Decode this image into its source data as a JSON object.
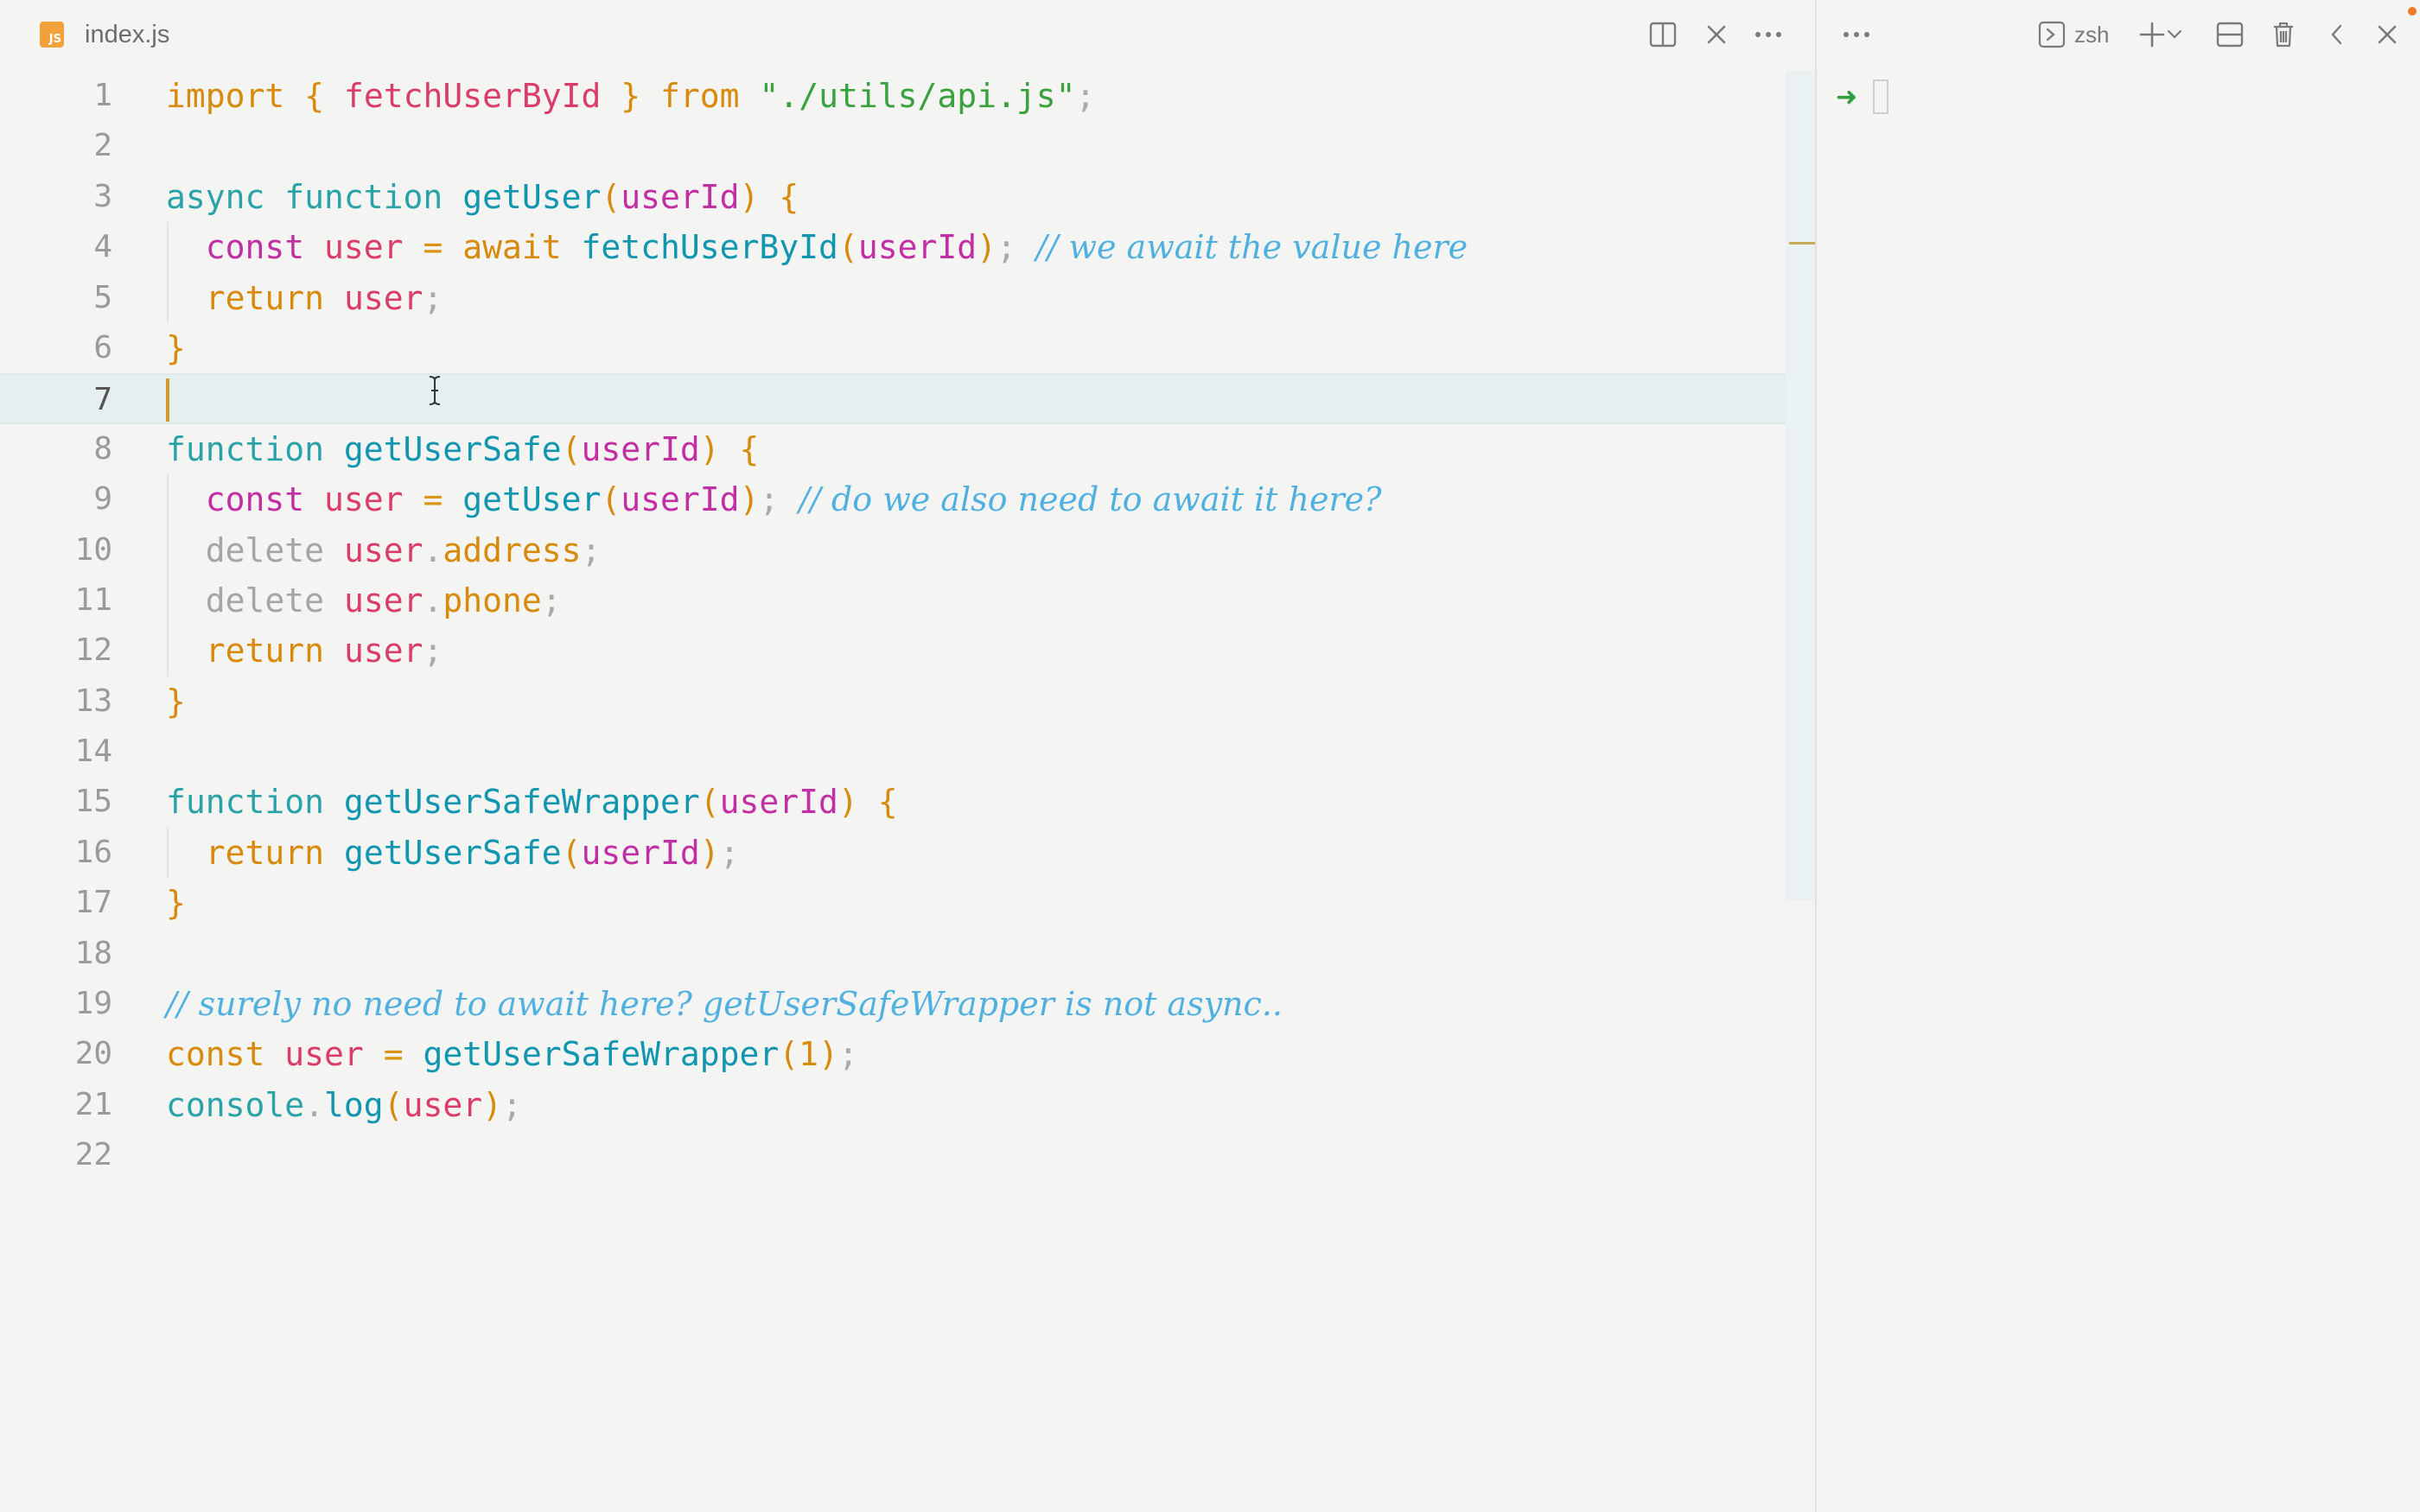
{
  "editor": {
    "tab_label": "index.js",
    "file_badge": "JS",
    "icons": [
      "split-editor-icon",
      "close-icon",
      "more-icon"
    ],
    "lines": [
      {
        "n": "1",
        "tokens": [
          [
            "import",
            "k-or"
          ],
          [
            " ",
            ""
          ],
          [
            "{",
            "br"
          ],
          [
            " ",
            ""
          ],
          [
            "fetchUserById",
            "vr"
          ],
          [
            " ",
            ""
          ],
          [
            "}",
            "br"
          ],
          [
            " ",
            ""
          ],
          [
            "from",
            "k-or"
          ],
          [
            " ",
            ""
          ],
          [
            "\"./utils/api.js\"",
            "st"
          ],
          [
            ";",
            "pu"
          ]
        ]
      },
      {
        "n": "2",
        "tokens": []
      },
      {
        "n": "3",
        "tokens": [
          [
            "async",
            "k-te"
          ],
          [
            " ",
            ""
          ],
          [
            "function",
            "k-te"
          ],
          [
            " ",
            ""
          ],
          [
            "getUser",
            "fn"
          ],
          [
            "(",
            "br"
          ],
          [
            "userId",
            "pr"
          ],
          [
            ")",
            "br"
          ],
          [
            " ",
            ""
          ],
          [
            "{",
            "br"
          ]
        ]
      },
      {
        "n": "4",
        "guide": true,
        "tokens": [
          [
            "  ",
            ""
          ],
          [
            "const",
            "pr"
          ],
          [
            " ",
            ""
          ],
          [
            "user",
            "vr"
          ],
          [
            " ",
            ""
          ],
          [
            "=",
            "pm"
          ],
          [
            " ",
            ""
          ],
          [
            "await",
            "k-or"
          ],
          [
            " ",
            ""
          ],
          [
            "fetchUserById",
            "fn"
          ],
          [
            "(",
            "br"
          ],
          [
            "userId",
            "pr"
          ],
          [
            ")",
            "br"
          ],
          [
            ";",
            "pu"
          ],
          [
            " ",
            ""
          ],
          [
            "// we await the value here",
            "cm"
          ]
        ]
      },
      {
        "n": "5",
        "guide": true,
        "tokens": [
          [
            "  ",
            ""
          ],
          [
            "return",
            "k-or"
          ],
          [
            " ",
            ""
          ],
          [
            "user",
            "vr"
          ],
          [
            ";",
            "pu"
          ]
        ]
      },
      {
        "n": "6",
        "tokens": [
          [
            "}",
            "br"
          ]
        ]
      },
      {
        "n": "7",
        "active": true,
        "tokens": []
      },
      {
        "n": "8",
        "tokens": [
          [
            "function",
            "k-te"
          ],
          [
            " ",
            ""
          ],
          [
            "getUserSafe",
            "fn"
          ],
          [
            "(",
            "br"
          ],
          [
            "userId",
            "pr"
          ],
          [
            ")",
            "br"
          ],
          [
            " ",
            ""
          ],
          [
            "{",
            "br"
          ]
        ]
      },
      {
        "n": "9",
        "guide": true,
        "tokens": [
          [
            "  ",
            ""
          ],
          [
            "const",
            "pr"
          ],
          [
            " ",
            ""
          ],
          [
            "user",
            "vr"
          ],
          [
            " ",
            ""
          ],
          [
            "=",
            "pm"
          ],
          [
            " ",
            ""
          ],
          [
            "getUser",
            "fn"
          ],
          [
            "(",
            "br"
          ],
          [
            "userId",
            "pr"
          ],
          [
            ")",
            "br"
          ],
          [
            ";",
            "pu"
          ],
          [
            " ",
            ""
          ],
          [
            "// do we also need to await it here?",
            "cm"
          ]
        ]
      },
      {
        "n": "10",
        "guide": true,
        "tokens": [
          [
            "  ",
            ""
          ],
          [
            "delete",
            "dl"
          ],
          [
            " ",
            ""
          ],
          [
            "user",
            "vr"
          ],
          [
            ".",
            "pu"
          ],
          [
            "address",
            "k-or"
          ],
          [
            ";",
            "pu"
          ]
        ]
      },
      {
        "n": "11",
        "guide": true,
        "tokens": [
          [
            "  ",
            ""
          ],
          [
            "delete",
            "dl"
          ],
          [
            " ",
            ""
          ],
          [
            "user",
            "vr"
          ],
          [
            ".",
            "pu"
          ],
          [
            "phone",
            "k-or"
          ],
          [
            ";",
            "pu"
          ]
        ]
      },
      {
        "n": "12",
        "guide": true,
        "tokens": [
          [
            "  ",
            ""
          ],
          [
            "return",
            "k-or"
          ],
          [
            " ",
            ""
          ],
          [
            "user",
            "vr"
          ],
          [
            ";",
            "pu"
          ]
        ]
      },
      {
        "n": "13",
        "tokens": [
          [
            "}",
            "br"
          ]
        ]
      },
      {
        "n": "14",
        "tokens": []
      },
      {
        "n": "15",
        "tokens": [
          [
            "function",
            "k-te"
          ],
          [
            " ",
            ""
          ],
          [
            "getUserSafeWrapper",
            "fn"
          ],
          [
            "(",
            "br"
          ],
          [
            "userId",
            "pr"
          ],
          [
            ")",
            "br"
          ],
          [
            " ",
            ""
          ],
          [
            "{",
            "br"
          ]
        ]
      },
      {
        "n": "16",
        "guide": true,
        "tokens": [
          [
            "  ",
            ""
          ],
          [
            "return",
            "k-or"
          ],
          [
            " ",
            ""
          ],
          [
            "getUserSafe",
            "fn"
          ],
          [
            "(",
            "br"
          ],
          [
            "userId",
            "pr"
          ],
          [
            ")",
            "br"
          ],
          [
            ";",
            "pu"
          ]
        ]
      },
      {
        "n": "17",
        "tokens": [
          [
            "}",
            "br"
          ]
        ]
      },
      {
        "n": "18",
        "tokens": []
      },
      {
        "n": "19",
        "tokens": [
          [
            "// surely no need to await here? getUserSafeWrapper is not async..",
            "cm"
          ]
        ]
      },
      {
        "n": "20",
        "tokens": [
          [
            "const",
            "k-or"
          ],
          [
            " ",
            ""
          ],
          [
            "user",
            "vr"
          ],
          [
            " ",
            ""
          ],
          [
            "=",
            "pm"
          ],
          [
            " ",
            ""
          ],
          [
            "getUserSafeWrapper",
            "fn"
          ],
          [
            "(",
            "br"
          ],
          [
            "1",
            "k-or"
          ],
          [
            ")",
            "br"
          ],
          [
            ";",
            "pu"
          ]
        ]
      },
      {
        "n": "21",
        "tokens": [
          [
            "console",
            "k-te"
          ],
          [
            ".",
            "pu"
          ],
          [
            "log",
            "fn"
          ],
          [
            "(",
            "br"
          ],
          [
            "user",
            "vr"
          ],
          [
            ")",
            "br"
          ],
          [
            ";",
            "pu"
          ]
        ]
      },
      {
        "n": "22",
        "tokens": []
      }
    ]
  },
  "terminal": {
    "shell_label": "zsh",
    "prompt_symbol": "➜",
    "icons": [
      "more-icon",
      "terminal-icon",
      "plus-icon",
      "chevron-down-icon",
      "split-terminal-icon",
      "trash-icon",
      "chevron-left-icon",
      "close-icon"
    ]
  },
  "colors": {
    "background": "#f4f4f2",
    "keyword_orange": "#d78a0b",
    "keyword_teal": "#2aa3a8",
    "function_blue": "#1196b0",
    "param_purple": "#c22ea3",
    "variable_red": "#db3d6b",
    "string_green": "#3aa13f",
    "comment_blue": "#50b0e0",
    "active_line": "#e6eff0"
  }
}
